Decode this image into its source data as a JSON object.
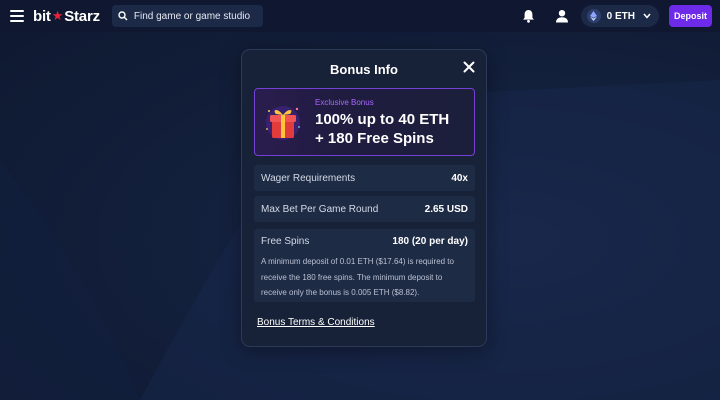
{
  "header": {
    "logo_left": "bit",
    "logo_right": "Starz",
    "search_placeholder": "Find game or game studio",
    "balance": "0 ETH",
    "deposit_label": "Deposit"
  },
  "modal": {
    "title": "Bonus Info",
    "promo": {
      "eyebrow": "Exclusive Bonus",
      "headline": "100% up to 40 ETH\n+ 180 Free Spins"
    },
    "rows": [
      {
        "label": "Wager Requirements",
        "value": "40x"
      },
      {
        "label": "Max Bet Per Game Round",
        "value": "2.65 USD"
      }
    ],
    "free_spins": {
      "label": "Free Spins",
      "value": "180 (20 per day)",
      "description": "A minimum deposit of 0.01 ETH ($17.64) is required to receive the 180 free spins. The minimum deposit to receive only the bonus is 0.005 ETH ($8.82)."
    },
    "terms_link": "Bonus Terms & Conditions"
  },
  "colors": {
    "accent": "#6d2ae8",
    "promo_border": "#7440d6",
    "eyebrow": "#a967ff",
    "logo_star": "#e8243b"
  },
  "icons": [
    "hamburger-icon",
    "logo-star-icon",
    "search-icon",
    "bell-icon",
    "user-icon",
    "eth-icon",
    "chevron-down-icon",
    "close-icon",
    "gift-icon"
  ]
}
